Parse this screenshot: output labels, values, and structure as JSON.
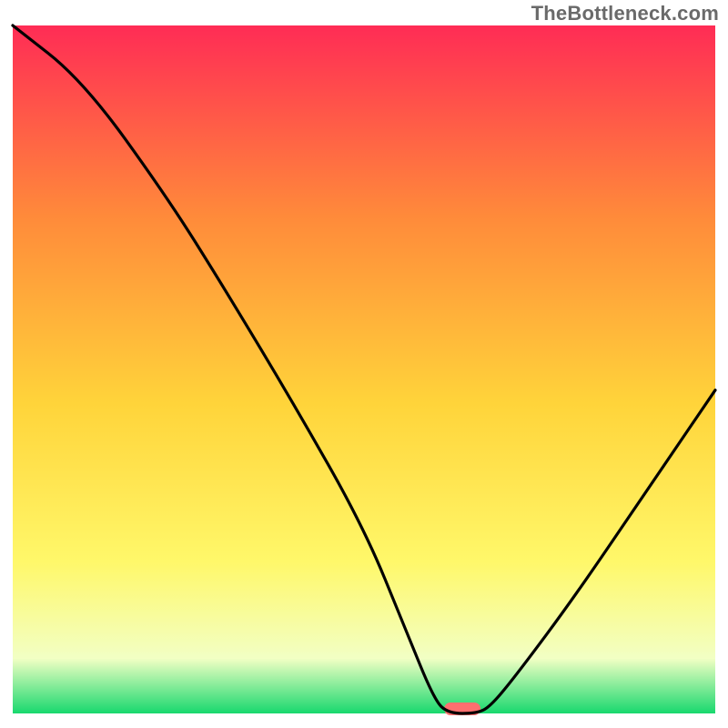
{
  "watermark": "TheBottleneck.com",
  "colors": {
    "top": "#ff2c55",
    "mid_upper": "#ff8b3a",
    "mid": "#ffd43a",
    "mid_lower": "#fff86a",
    "pale": "#f2ffc4",
    "green": "#18d86e",
    "curve": "#000000",
    "marker": "#ff6f6f",
    "frame_bg": "#ffffff"
  },
  "chart_data": {
    "type": "line",
    "title": "",
    "xlabel": "",
    "ylabel": "",
    "x_range": [
      0,
      100
    ],
    "y_range": [
      0,
      100
    ],
    "marker_x": 64,
    "series": [
      {
        "name": "bottleneck-curve",
        "points": [
          {
            "x": 0,
            "y": 100
          },
          {
            "x": 10,
            "y": 92
          },
          {
            "x": 22,
            "y": 75
          },
          {
            "x": 30,
            "y": 62
          },
          {
            "x": 40,
            "y": 45
          },
          {
            "x": 50,
            "y": 27
          },
          {
            "x": 56,
            "y": 12
          },
          {
            "x": 60,
            "y": 2
          },
          {
            "x": 62,
            "y": 0
          },
          {
            "x": 66,
            "y": 0
          },
          {
            "x": 68,
            "y": 1
          },
          {
            "x": 72,
            "y": 6
          },
          {
            "x": 80,
            "y": 17
          },
          {
            "x": 90,
            "y": 32
          },
          {
            "x": 100,
            "y": 47
          }
        ]
      }
    ]
  }
}
